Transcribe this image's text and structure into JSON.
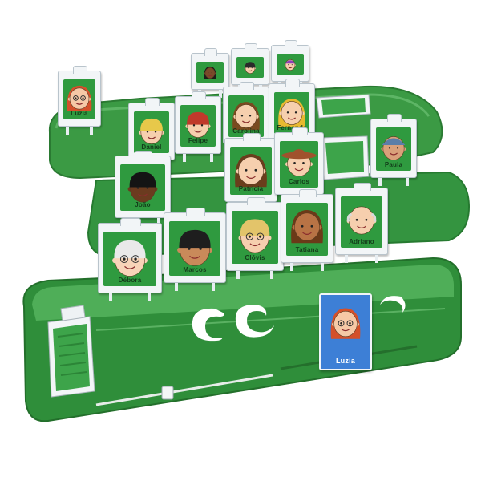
{
  "colors": {
    "board_dark": "#2b7d34",
    "board_mid": "#3a9a43",
    "board_light": "#5cb865",
    "card_frame": "#f2f5f7",
    "card_inner": "#2f9a3f",
    "secret_card": "#3d7fd6"
  },
  "icons": [
    "face-portrait-icon",
    "slider-handle-icon",
    "card-tray-icon"
  ],
  "cards": [
    {
      "name": "Luzia",
      "skin": "#f6c9a6",
      "hair": "#d4502a",
      "glasses": true,
      "hair_style": "long"
    },
    {
      "name": "",
      "skin": "#7a4a2a",
      "hair": "#1e1a18",
      "glasses": false,
      "hair_style": "long"
    },
    {
      "name": "",
      "skin": "#f6cfae",
      "hair": "#2a2a2a",
      "glasses": false,
      "hair_style": "short"
    },
    {
      "name": "",
      "skin": "#f6cfae",
      "hair": "#8d3fb8",
      "glasses": false,
      "hair_style": "cap"
    },
    {
      "name": "Daniel",
      "skin": "#f6cfae",
      "hair": "#e7c84a",
      "glasses": false,
      "hair_style": "short"
    },
    {
      "name": "Felipe",
      "skin": "#f6cfae",
      "hair": "#c0392b",
      "glasses": false,
      "hair_style": "short"
    },
    {
      "name": "Carolina",
      "skin": "#f6cfae",
      "hair": "#7a4a1f",
      "glasses": false,
      "hair_style": "long"
    },
    {
      "name": "Fernanda",
      "skin": "#f6cfae",
      "hair": "#e8b930",
      "glasses": false,
      "hair_style": "long"
    },
    {
      "name": "Paula",
      "skin": "#d9a07a",
      "hair": "#5a7ea8",
      "glasses": false,
      "hair_style": "cap"
    },
    {
      "name": "João",
      "skin": "#6b3b1f",
      "hair": "#141414",
      "glasses": false,
      "hair_style": "short"
    },
    {
      "name": "Patricia",
      "skin": "#f6cfae",
      "hair": "#6a3e1c",
      "glasses": false,
      "hair_style": "long"
    },
    {
      "name": "Carlos",
      "skin": "#f6cfae",
      "hair": "#a0522d",
      "glasses": false,
      "hair_style": "hat"
    },
    {
      "name": "Débora",
      "skin": "#f8d4b8",
      "hair": "#e9e9e9",
      "glasses": true,
      "hair_style": "short"
    },
    {
      "name": "Marcos",
      "skin": "#c98a5a",
      "hair": "#1e1e1e",
      "glasses": false,
      "hair_style": "short"
    },
    {
      "name": "Clóvis",
      "skin": "#f6cfae",
      "hair": "#e3c46a",
      "glasses": true,
      "hair_style": "short"
    },
    {
      "name": "Tatiana",
      "skin": "#b87345",
      "hair": "#6b3a18",
      "glasses": false,
      "hair_style": "long"
    },
    {
      "name": "Adriano",
      "skin": "#f6cfae",
      "hair": "#d9d9d9",
      "glasses": false,
      "hair_style": "bald"
    }
  ],
  "secret_card": {
    "name": "Luzia",
    "skin": "#f6c9a6",
    "hair": "#d4502a",
    "glasses": true,
    "hair_style": "long"
  }
}
